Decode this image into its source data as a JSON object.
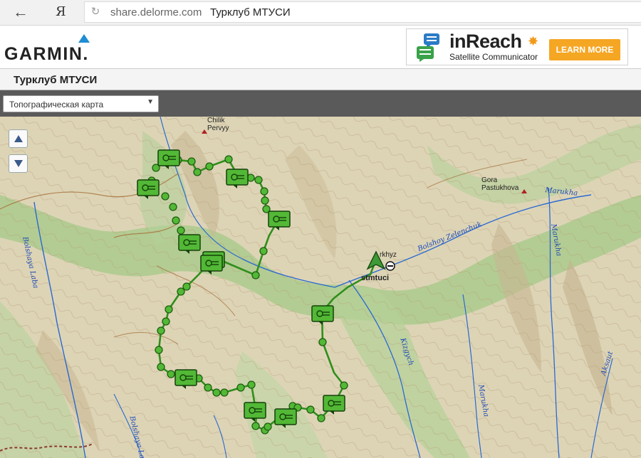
{
  "browser": {
    "back_glyph": "←",
    "yandex_glyph": "Я",
    "reload_glyph": "↻",
    "url_domain": "share.delorme.com",
    "url_title": "Турклуб МТУСИ"
  },
  "header": {
    "logo_text": "GARMIN.",
    "ad": {
      "title": "inReach",
      "subtitle": "Satellite Communicator",
      "cta": "LEARN MORE"
    }
  },
  "page": {
    "title": "Турклуб МТУСИ"
  },
  "toolbar": {
    "map_type": "Топографическая карта",
    "map_type_arrow": "▼"
  },
  "map": {
    "peaks": [
      {
        "name_line1": "Chilik",
        "name_line2": "Pervyy"
      },
      {
        "name_line1": "Gora",
        "name_line2": "Pastukhova"
      }
    ],
    "rivers": {
      "bolshaya_laba": "Bolshaya Laba",
      "bolshoy_zelenchuk": "Bolshoy Zelenchuk",
      "marukha_top": "Marukha",
      "marukha_right": "Marukha",
      "marukha_bottom": "Marukha",
      "kizgych": "Kizgych",
      "aksaut": "Aksaut",
      "bolshaya_laba_bottom": "Bolshaya La"
    },
    "place": "rkhyz",
    "tracker_name": "stmtuci",
    "colors": {
      "track": "#2f8f1c",
      "marker": "#52b836",
      "water": "#1c4ab5"
    }
  }
}
